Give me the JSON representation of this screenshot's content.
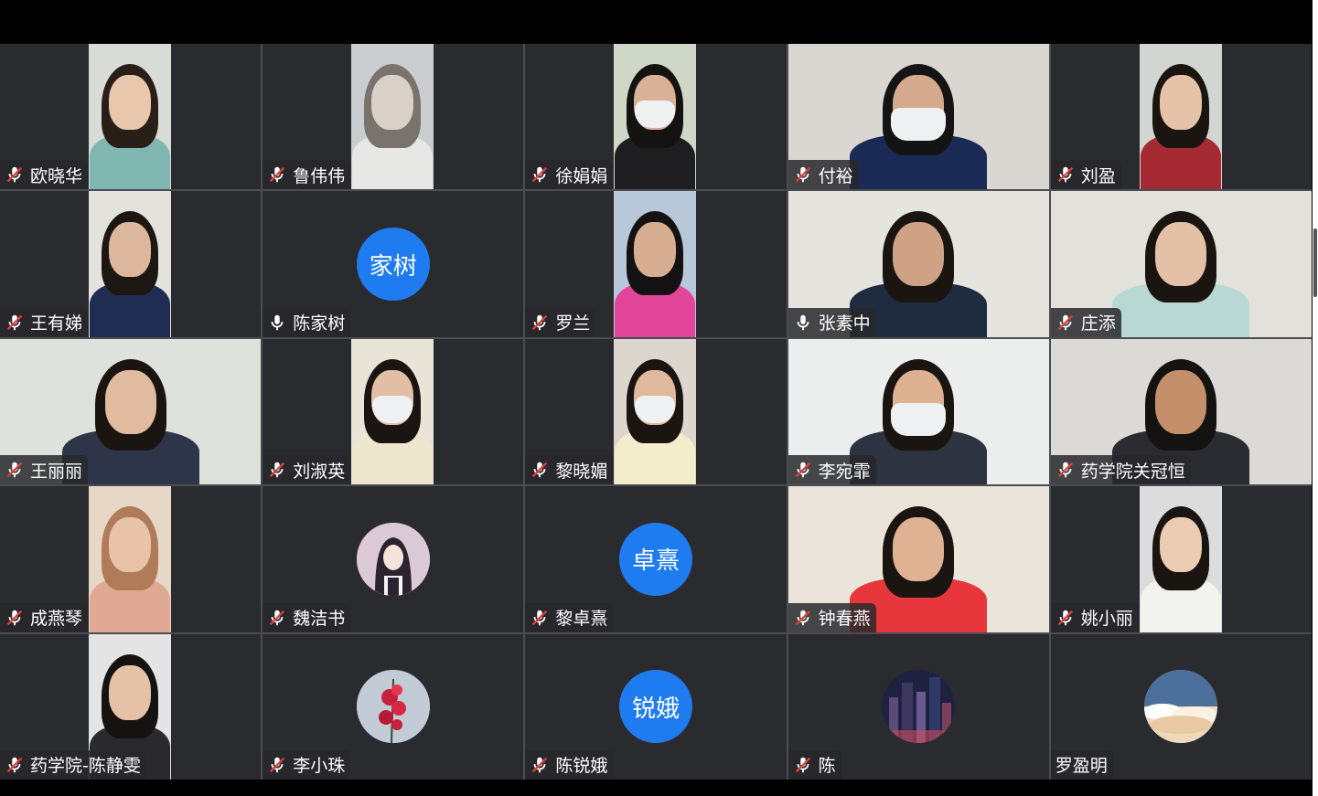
{
  "participants": [
    {
      "name": "欧晓华",
      "mic": "muted",
      "kind": "video",
      "skin": "#e9c7ad",
      "bg": "#d9dcd6",
      "shirt": "#7fb7b0",
      "hair": "#2a1e18"
    },
    {
      "name": "鲁伟伟",
      "mic": "muted",
      "kind": "video",
      "skin": "#d9d0c8",
      "bg": "#c9cdcf",
      "shirt": "#e7e7e5",
      "hair": "#7a726d"
    },
    {
      "name": "徐娟娟",
      "mic": "muted",
      "kind": "video",
      "skin": "#d9b197",
      "bg": "#cfd7c8",
      "shirt": "#1e1e20",
      "hair": "#151212",
      "mask": true
    },
    {
      "name": "付裕",
      "mic": "muted",
      "kind": "video-full",
      "skin": "#d4a98e",
      "bg": "#dad6d1",
      "shirt": "#1a2a55",
      "hair": "#141414",
      "mask": true
    },
    {
      "name": "刘盈",
      "mic": "muted",
      "kind": "video",
      "skin": "#e6c3a8",
      "bg": "#d2d6d3",
      "shirt": "#a62a34",
      "hair": "#1b1512"
    },
    {
      "name": "王有娣",
      "mic": "muted",
      "kind": "video",
      "skin": "#dcb79d",
      "bg": "#e4e2dc",
      "shirt": "#1f2d52",
      "hair": "#1d1713"
    },
    {
      "name": "陈家树",
      "mic": "on",
      "kind": "avatar-text",
      "avatar_text": "家树"
    },
    {
      "name": "罗兰",
      "mic": "muted",
      "kind": "video",
      "skin": "#d8ae93",
      "bg": "#b8c8d8",
      "shirt": "#e2459a",
      "hair": "#141212"
    },
    {
      "name": "张素中",
      "mic": "on",
      "kind": "video-full",
      "skin": "#cfa286",
      "bg": "#e6e4df",
      "shirt": "#1f2c3f",
      "hair": "#1b1512"
    },
    {
      "name": "庄添",
      "mic": "muted",
      "kind": "video-full",
      "skin": "#e4c1a6",
      "bg": "#e3e1dc",
      "shirt": "#b8d8d4",
      "hair": "#1b1512"
    },
    {
      "name": "王丽丽",
      "mic": "muted",
      "kind": "video-full",
      "skin": "#e1bb9f",
      "bg": "#dfe1dc",
      "shirt": "#2e3548",
      "hair": "#1b1512"
    },
    {
      "name": "刘淑英",
      "mic": "muted",
      "kind": "video",
      "skin": "#e2bea4",
      "bg": "#e9e4d8",
      "shirt": "#efe6cf",
      "hair": "#1b1512",
      "mask": true
    },
    {
      "name": "黎晓媚",
      "mic": "muted",
      "kind": "video",
      "skin": "#e0b89c",
      "bg": "#ddd6cf",
      "shirt": "#f4edcc",
      "hair": "#1b1512",
      "mask": true
    },
    {
      "name": "李宛霏",
      "mic": "muted",
      "kind": "video-full",
      "skin": "#dcb293",
      "bg": "#eceeee",
      "shirt": "#2d3340",
      "hair": "#1b1512",
      "mask": true
    },
    {
      "name": "药学院关冠恒",
      "mic": "muted",
      "kind": "video-full",
      "skin": "#c48f6b",
      "bg": "#dbdad6",
      "shirt": "#2a2c31",
      "hair": "#151212"
    },
    {
      "name": "成燕琴",
      "mic": "muted",
      "kind": "video",
      "skin": "#e8c2a9",
      "bg": "#e7d7c6",
      "shirt": "#e0a995",
      "hair": "#b07b58"
    },
    {
      "name": "魏洁书",
      "mic": "muted",
      "kind": "avatar-img",
      "avatar_icon": "girl-illustration-icon",
      "av_bg": "#d9c7d3"
    },
    {
      "name": "黎卓熹",
      "mic": "muted",
      "kind": "avatar-text",
      "avatar_text": "卓熹"
    },
    {
      "name": "钟春燕",
      "mic": "muted",
      "kind": "video-full",
      "skin": "#deb293",
      "bg": "#eae4da",
      "shirt": "#e7373c",
      "hair": "#1b1512"
    },
    {
      "name": "姚小丽",
      "mic": "muted",
      "kind": "video",
      "skin": "#eccbb3",
      "bg": "#dcdcdc",
      "shirt": "#f2f2ee",
      "hair": "#1b1512"
    },
    {
      "name": "药学院-陈静雯",
      "mic": "muted",
      "kind": "video",
      "skin": "#e5c2a6",
      "bg": "#e4e4e4",
      "shirt": "#2a2a2c",
      "hair": "#151212"
    },
    {
      "name": "李小珠",
      "mic": "muted",
      "kind": "avatar-img",
      "avatar_icon": "flower-photo-icon",
      "av_bg": "#b8c3cf"
    },
    {
      "name": "陈锐娥",
      "mic": "muted",
      "kind": "avatar-text",
      "avatar_text": "锐娥"
    },
    {
      "name": "陈",
      "mic": "muted",
      "kind": "avatar-img",
      "avatar_icon": "city-night-icon",
      "av_bg": "#2c2f48"
    },
    {
      "name": "罗盈明",
      "mic": "none",
      "kind": "avatar-img",
      "avatar_icon": "cloud-sky-icon",
      "av_bg": "#9fb6d3"
    }
  ],
  "colors": {
    "accent": "#1f7cf0",
    "muted_red": "#e0403a",
    "tile_bg": "#2a2b2f"
  }
}
